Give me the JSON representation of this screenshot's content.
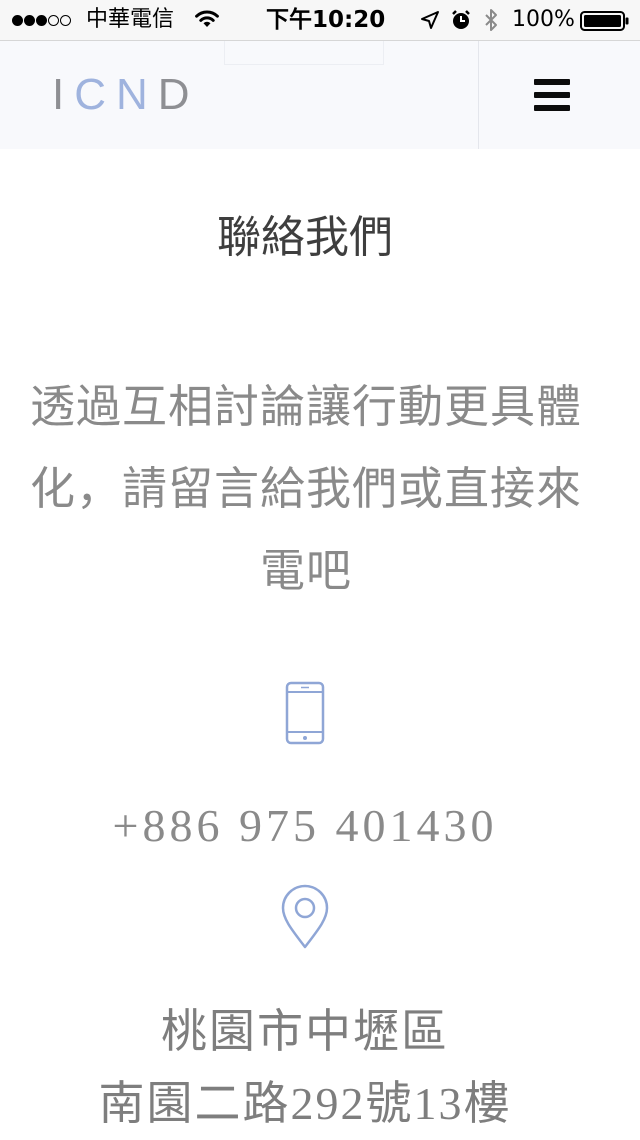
{
  "status_bar": {
    "carrier": "中華電信",
    "time": "下午10:20",
    "battery": "100%",
    "signal": {
      "filled": 3,
      "total": 5
    },
    "icons": [
      "wifi-icon",
      "location-arrow-icon",
      "alarm-icon",
      "bluetooth-icon",
      "battery-icon"
    ]
  },
  "header": {
    "logo_letters": [
      "I",
      "C",
      "N",
      "D"
    ],
    "menu_icon": "hamburger-menu-icon"
  },
  "main": {
    "title": "聯絡我們",
    "intro_lines": [
      "透過互相討論讓行動更具體",
      "化，請留言給我們或直接來",
      "電吧"
    ],
    "phone_icon": "mobile-phone-icon",
    "phone": "+886 975 401430",
    "location_icon": "map-pin-icon",
    "address_lines": [
      "桃園市中壢區",
      "南園二路292號13樓"
    ]
  },
  "colors": {
    "accent_blue": "#9fb3de",
    "icon_blue": "#8fa6d6",
    "logo_grey": "#8e8f93",
    "title_text": "#3e3e3e",
    "body_text": "#8a8a8a",
    "header_bg": "#f8f9fc"
  }
}
